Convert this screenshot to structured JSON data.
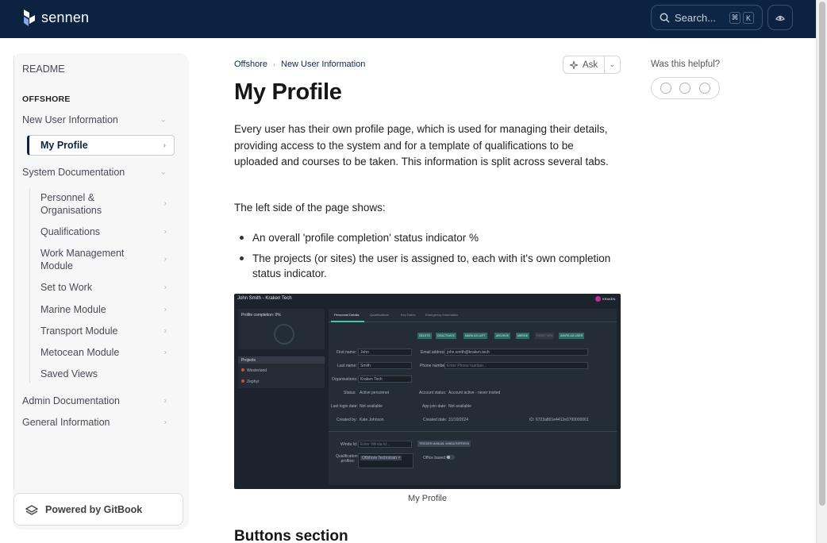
{
  "header": {
    "brand": "sennen",
    "search_placeholder": "Search...",
    "kbd_cmd": "⌘",
    "kbd_k": "K",
    "theme_icon": "theme-toggle-icon"
  },
  "sidebar": {
    "readme": "README",
    "section": "OFFSHORE",
    "new_user_info": "New User Information",
    "active": "My Profile",
    "system_docs": "System Documentation",
    "sub_items": [
      "Personnel & Organisations",
      "Qualifications",
      "Work Management Module",
      "Set to Work",
      "Marine Module",
      "Transport Module",
      "Metocean Module",
      "Saved Views"
    ],
    "admin_docs": "Admin Documentation",
    "general_info": "General Information",
    "powered_by": "Powered by GitBook"
  },
  "breadcrumb": {
    "root": "Offshore",
    "current": "New User Information"
  },
  "ask_label": "Ask",
  "page": {
    "title": "My Profile",
    "intro": "Every user has their own profile page, which is used for managing their details, providing access to the system and for a template of qualifications to be uploaded and courses to be taken. This information is split across several tabs.",
    "left_side": "The left side of the page shows:",
    "bullets": [
      "An overall 'profile completion' status indicator %",
      "The projects (or sites) the user is assigned to, each with it's own completion status indicator."
    ],
    "caption": "My Profile",
    "next_heading": "Buttons section"
  },
  "feedback": {
    "question": "Was this helpful?"
  },
  "screenshot": {
    "window_title": "John Smith - Kraken Tech",
    "brand": "KRAKEN",
    "profile_completion": "Profile completion: 0%",
    "projects_header": "Projects",
    "projects": [
      "Westerland",
      "Zephyr"
    ],
    "tabs": [
      "Personnel Details",
      "Qualifications",
      "Key Dates",
      "Emergency Information"
    ],
    "buttons": [
      "DELETE",
      "DEACTIVATE",
      "MARK AS LEFT",
      "ARCHIVE",
      "MERGE",
      "RESET MFA",
      "INVITE AS USER"
    ],
    "labels": {
      "first_name": "First name:",
      "last_name": "Last name:",
      "organisations": "Organisations:",
      "status": "Status:",
      "last_login": "Last login date:",
      "created_by": "Created by:",
      "email": "Email address:",
      "phone": "Phone number:",
      "account_status": "Account status:",
      "app_join": "App join date:",
      "created_date": "Created date:",
      "id": "ID:",
      "winda": "Winda Id:",
      "qual_profiles": "Qualification profiles:",
      "office_based": "Office based:"
    },
    "values": {
      "first_name": "John",
      "last_name": "Smith",
      "organisation": "Kraken Tech",
      "status": "Active personnel",
      "last_login": "Not available",
      "created_by": "Kate Johnson",
      "email": "john.smith@kraken.tech",
      "phone_placeholder": "Enter Phone number...",
      "account_status": "Account active - never invited",
      "app_join": "Not available",
      "created_date": "31/10/2024",
      "id": "6723a801e4412e0700000001",
      "winda_placeholder": "Enter Winda Id...",
      "qual_profile": "Offshore Technician ×",
      "trigger": "TRIGGER MANUAL WINDA REFRESH"
    }
  }
}
